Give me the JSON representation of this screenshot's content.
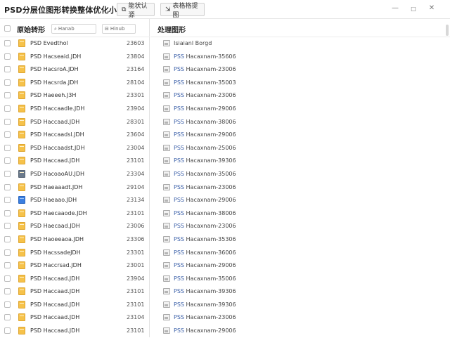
{
  "toolbar": {
    "app_title": "PSD分层位图形转换整体优化小转换",
    "btn1_icon": "copy-icon",
    "btn1_label": "能状认源",
    "btn2_icon": "expand-icon",
    "btn2_label": "表格格提图",
    "window_controls": {
      "minimize": "—",
      "maximize": "□",
      "close": "✕"
    }
  },
  "left": {
    "header_label": "原始转形",
    "search_icon": "search-icon",
    "search_value": "Hanab",
    "sort_icon": "sort-icon",
    "sort_value": "Hinub",
    "files": [
      {
        "name": "PSD Evedthol",
        "num": "23603",
        "icon": "yellow"
      },
      {
        "name": "PSD Hacseaid.JDH",
        "num": "23804",
        "icon": "yellow"
      },
      {
        "name": "PSD HacsroA.JDH",
        "num": "23164",
        "icon": "yellow"
      },
      {
        "name": "PSD Hacsrda.JDH",
        "num": "28104",
        "icon": "yellow"
      },
      {
        "name": "PSD Haeeeh.J3H",
        "num": "23301",
        "icon": "yellow"
      },
      {
        "name": "PSD Haccaadle.JDH",
        "num": "23904",
        "icon": "yellow"
      },
      {
        "name": "PSD Haccaad.JDH",
        "num": "28301",
        "icon": "yellow"
      },
      {
        "name": "PSD Haccaadsl.JDH",
        "num": "23604",
        "icon": "yellow"
      },
      {
        "name": "PSD Haccaadst.JDH",
        "num": "23004",
        "icon": "yellow"
      },
      {
        "name": "PSD Haccaad.JDH",
        "num": "23101",
        "icon": "yellow"
      },
      {
        "name": "PSD HacoaoAU.JDH",
        "num": "23304",
        "icon": "dark"
      },
      {
        "name": "PSD Haeaaadt.JDH",
        "num": "29104",
        "icon": "yellow"
      },
      {
        "name": "PSD Haeaao.JDH",
        "num": "23134",
        "icon": "blue"
      },
      {
        "name": "PSD Haecaaode.JDH",
        "num": "23101",
        "icon": "yellow"
      },
      {
        "name": "PSD Haecaad.JDH",
        "num": "23006",
        "icon": "yellow"
      },
      {
        "name": "PSD Haoeeaoa.JDH",
        "num": "23306",
        "icon": "yellow"
      },
      {
        "name": "PSD HacssadeJDH",
        "num": "23301",
        "icon": "yellow"
      },
      {
        "name": "PSD Haccrsad.JDH",
        "num": "23001",
        "icon": "yellow"
      },
      {
        "name": "PSD Haccaad.JDH",
        "num": "23904",
        "icon": "yellow"
      },
      {
        "name": "PSD Haccaad.JDH",
        "num": "23101",
        "icon": "yellow"
      },
      {
        "name": "PSD Haccaad.JDH",
        "num": "23101",
        "icon": "yellow"
      },
      {
        "name": "PSD Haccaad.JDH",
        "num": "23104",
        "icon": "yellow"
      },
      {
        "name": "PSD Haccaad.JDH",
        "num": "23101",
        "icon": "yellow"
      }
    ]
  },
  "right": {
    "title": "处理图形",
    "previews": [
      {
        "prefix": "",
        "name": "Isiaianl Borgd"
      },
      {
        "prefix": "PSS",
        "name": " Hacaxnam-35606"
      },
      {
        "prefix": "PSS",
        "name": " Hacaxnam-23006"
      },
      {
        "prefix": "PSS",
        "name": " Hacaxnam-35003"
      },
      {
        "prefix": "PSS",
        "name": " Hacaxnam-23006"
      },
      {
        "prefix": "PSS",
        "name": " Hacaxnam-29006"
      },
      {
        "prefix": "PSS",
        "name": " Hacaxnam-38006"
      },
      {
        "prefix": "PSS",
        "name": " Hacaxnam-29006"
      },
      {
        "prefix": "PSS",
        "name": " Hacaxnam-25006"
      },
      {
        "prefix": "PSS",
        "name": " Hacaxnam-39306"
      },
      {
        "prefix": "PSS",
        "name": " Hacaxnam-35006"
      },
      {
        "prefix": "PSS",
        "name": " Hacaxnam-23006"
      },
      {
        "prefix": "PSS",
        "name": " Hacaxnam-29006"
      },
      {
        "prefix": "PSS",
        "name": " Hacaxnam-38006"
      },
      {
        "prefix": "PSS",
        "name": " Hacaxnam-23006"
      },
      {
        "prefix": "PSS",
        "name": " Hacaxnam-35306"
      },
      {
        "prefix": "PSS",
        "name": " Hacaxnam-36006"
      },
      {
        "prefix": "PSS",
        "name": " Hacaxnam-29006"
      },
      {
        "prefix": "PSS",
        "name": " Hacaxnam-35006"
      },
      {
        "prefix": "PSS",
        "name": " Hacaxnam-39306"
      },
      {
        "prefix": "PSS",
        "name": " Hacaxnam-39306"
      },
      {
        "prefix": "PSS",
        "name": " Hacaxnam-23006"
      },
      {
        "prefix": "PSS",
        "name": " Hacaxnam-29006"
      }
    ]
  }
}
